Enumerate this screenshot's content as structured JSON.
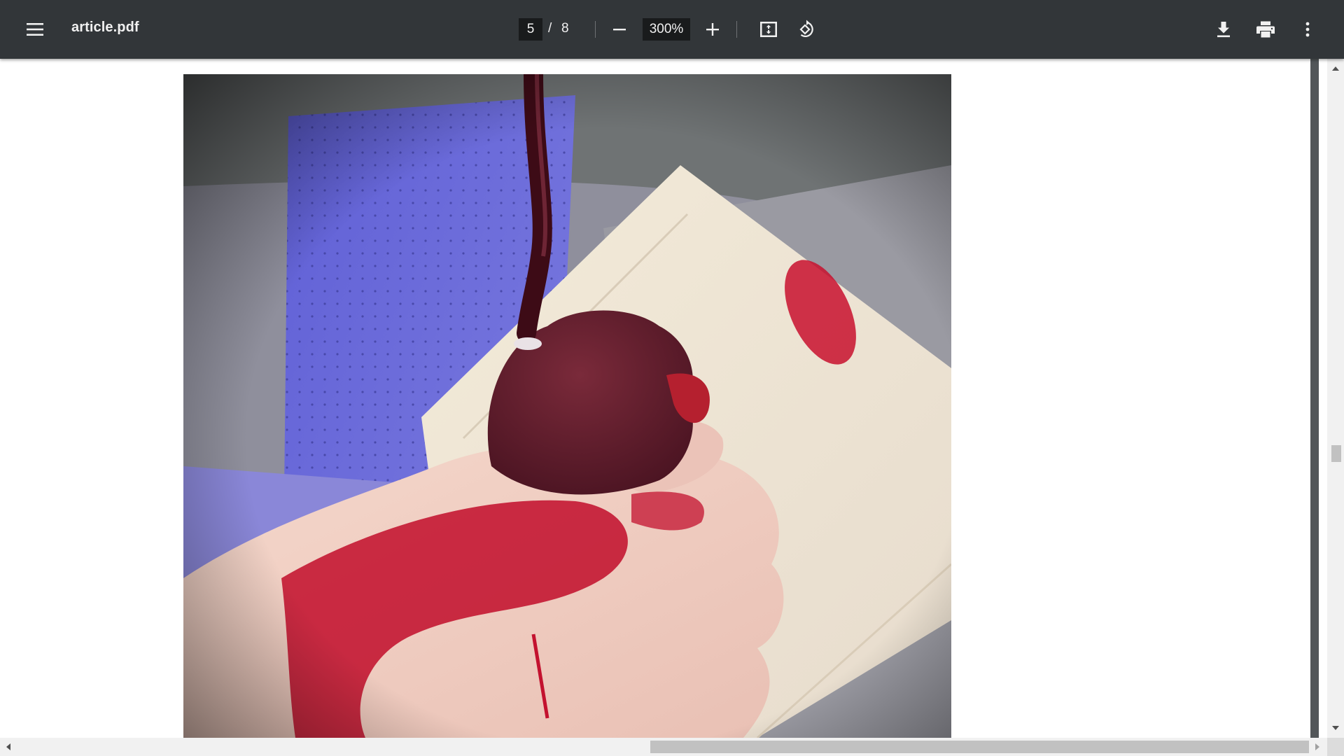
{
  "toolbar": {
    "menu_icon": "hamburger-menu-icon",
    "file_name": "article.pdf",
    "current_page": "5",
    "page_separator": "/",
    "total_pages": "8",
    "zoom_level": "300%",
    "zoom_out_icon": "minus-icon",
    "zoom_in_icon": "plus-icon",
    "fit_icon": "fit-to-page-icon",
    "rotate_icon": "rotate-counterclockwise-icon",
    "download_icon": "download-icon",
    "print_icon": "print-icon",
    "more_icon": "more-vertical-icon"
  },
  "document": {
    "figure_alt": "Surgical photo: gloved hand holding a dark red organ with a catheter, blood on glove, gauze pad and blue drape"
  },
  "colors": {
    "toolbar_bg": "#323639",
    "toolbar_text": "#f1f1f1",
    "input_bg": "#191b1c",
    "scrollbar_thumb": "#c1c1c1"
  }
}
